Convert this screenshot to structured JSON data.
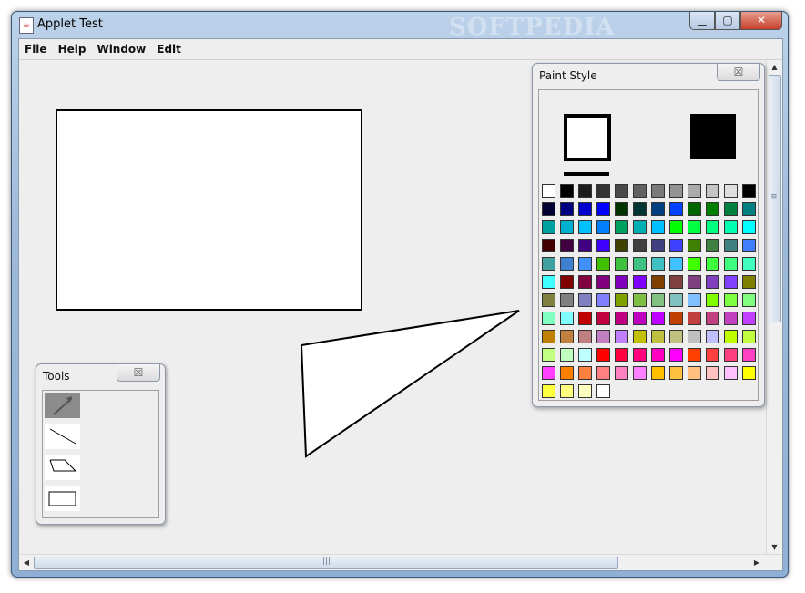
{
  "window": {
    "title": "Applet Test",
    "watermark": "SOFTPEDIA",
    "icon": "java-icon",
    "buttons": {
      "minimize": "▁",
      "maximize": "▢",
      "close": "✕"
    }
  },
  "menu": [
    "File",
    "Help",
    "Window",
    "Edit"
  ],
  "paint_style": {
    "title": "Paint Style",
    "close_glyph": "☒",
    "stroke_color": "#000000",
    "fill_color": "#000000",
    "colors": [
      "#ffffff",
      "#000000",
      "#1c1c1c",
      "#333333",
      "#4a4a4a",
      "#616161",
      "#7a7a7a",
      "#939393",
      "#ababab",
      "#c4c4c4",
      "#dedede",
      "#000000",
      "#000033",
      "#000080",
      "#0000cc",
      "#0000ff",
      "#003300",
      "#003333",
      "#004080",
      "#0040ff",
      "#006600",
      "#008000",
      "#008040",
      "#008080",
      "#00a0a0",
      "#00b0d0",
      "#00c0ff",
      "#0080ff",
      "#00a060",
      "#00b0b0",
      "#00c0ff",
      "#00ff00",
      "#00ff40",
      "#00ff80",
      "#00ffb0",
      "#00ffff",
      "#400000",
      "#400040",
      "#400080",
      "#4000ff",
      "#404000",
      "#404040",
      "#404080",
      "#4040ff",
      "#408000",
      "#408040",
      "#408080",
      "#4080ff",
      "#40a0a0",
      "#4080d0",
      "#4090ff",
      "#40c000",
      "#40c040",
      "#40c080",
      "#40c0c0",
      "#40c0ff",
      "#40ff00",
      "#40ff40",
      "#40ff80",
      "#40ffc0",
      "#40ffff",
      "#800000",
      "#800040",
      "#800080",
      "#8000c0",
      "#8000ff",
      "#804000",
      "#804040",
      "#804080",
      "#8040c0",
      "#8040ff",
      "#808000",
      "#808040",
      "#808080",
      "#8080c0",
      "#8080ff",
      "#80a000",
      "#80c040",
      "#80c080",
      "#80c0c0",
      "#80c0ff",
      "#80ff00",
      "#80ff40",
      "#80ff80",
      "#80ffc0",
      "#80ffff",
      "#c00000",
      "#c00040",
      "#c00080",
      "#c000c0",
      "#c000ff",
      "#c04000",
      "#c04040",
      "#c04080",
      "#c040c0",
      "#c040ff",
      "#c08000",
      "#c08040",
      "#c08080",
      "#c080c0",
      "#c080ff",
      "#c0c000",
      "#c0c040",
      "#c0c080",
      "#c0c0c0",
      "#c0c0ff",
      "#c0ff00",
      "#c0ff40",
      "#c0ff80",
      "#c0ffc0",
      "#c0ffff",
      "#ff0000",
      "#ff0040",
      "#ff0080",
      "#ff00c0",
      "#ff00ff",
      "#ff4000",
      "#ff4040",
      "#ff4080",
      "#ff40c0",
      "#ff40ff",
      "#ff8000",
      "#ff8040",
      "#ff8080",
      "#ff80c0",
      "#ff80ff",
      "#ffc000",
      "#ffc040",
      "#ffc080",
      "#ffc0c0",
      "#ffc0ff",
      "#ffff00",
      "#ffff40",
      "#ffff80",
      "#ffffc0",
      "#ffffff"
    ]
  },
  "tools": {
    "title": "Tools",
    "close_glyph": "☒",
    "items": [
      "select-arrow-icon",
      "line-tool-icon",
      "polygon-tool-icon",
      "rectangle-tool-icon"
    ]
  }
}
